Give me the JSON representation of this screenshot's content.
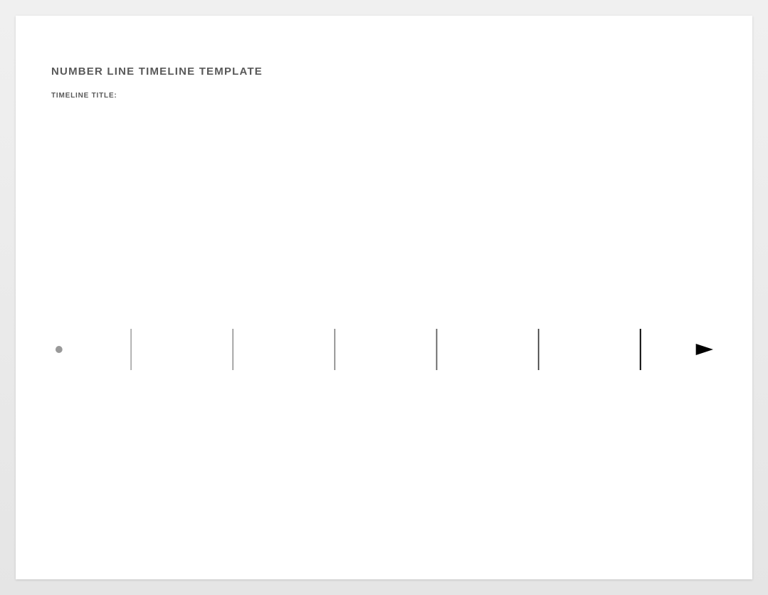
{
  "header": {
    "title": "NUMBER LINE TIMELINE TEMPLATE",
    "subtitle": "TIMELINE TITLE:"
  },
  "timeline": {
    "tick_count": 6,
    "colors": {
      "start": "#999999",
      "end": "#000000"
    }
  }
}
